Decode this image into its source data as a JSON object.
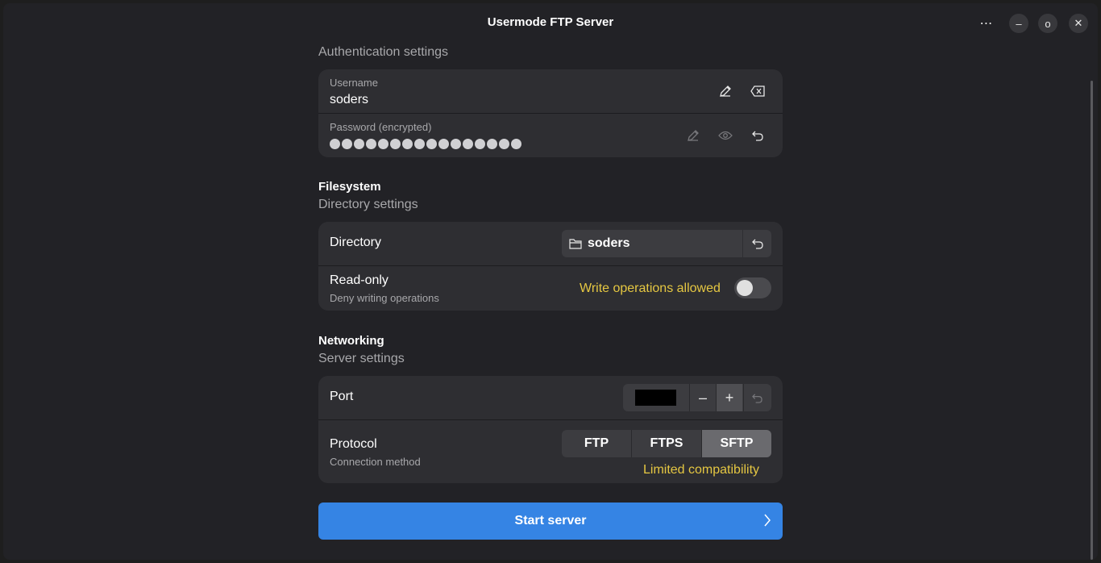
{
  "window": {
    "title": "Usermode FTP Server",
    "menu_icon": "⋯",
    "minimize_icon": "–",
    "maximize_icon": "o",
    "close_icon": "✕"
  },
  "auth": {
    "description": "Authentication settings",
    "username_label": "Username",
    "username_value": "soders",
    "password_label": "Password (encrypted)",
    "password_dot_count": 16
  },
  "filesystem": {
    "heading": "Filesystem",
    "description": "Directory settings",
    "directory_label": "Directory",
    "directory_value": "soders",
    "readonly_title": "Read-only",
    "readonly_subtitle": "Deny writing operations",
    "readonly_status": "Write operations allowed",
    "readonly_enabled": false
  },
  "networking": {
    "heading": "Networking",
    "description": "Server settings",
    "port_label": "Port",
    "protocol_title": "Protocol",
    "protocol_subtitle": "Connection method",
    "protocols": [
      "FTP",
      "FTPS",
      "SFTP"
    ],
    "protocol_selected": "SFTP",
    "protocol_warning": "Limited compatibility"
  },
  "actions": {
    "start_label": "Start server"
  },
  "colors": {
    "accent": "#3584e4",
    "warning": "#e5c742",
    "background": "#222226",
    "card": "#2e2e32"
  },
  "icons": {
    "edit": "pencil-icon",
    "clear": "backspace-icon",
    "reveal": "eye-icon",
    "reset": "undo-icon",
    "folder": "folder-icon",
    "chevron": "chevron-right-icon"
  }
}
